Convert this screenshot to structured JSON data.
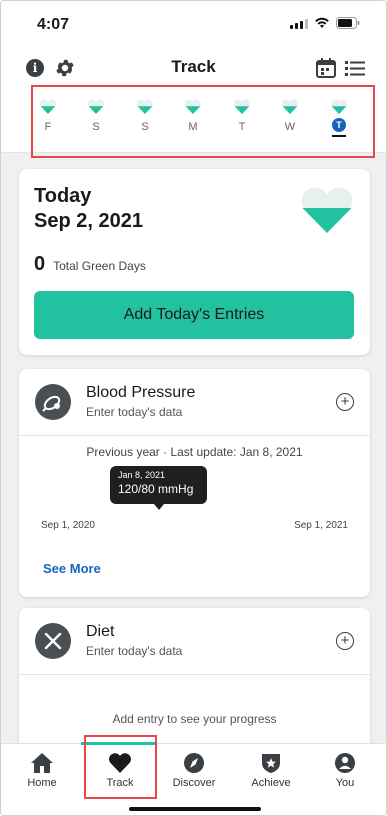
{
  "status_bar": {
    "time": "4:07"
  },
  "header": {
    "title": "Track",
    "icons": [
      "info-icon",
      "gear-icon",
      "calendar-icon",
      "list-icon"
    ]
  },
  "week": {
    "days": [
      {
        "label": "F",
        "active": false
      },
      {
        "label": "S",
        "active": false
      },
      {
        "label": "S",
        "active": false
      },
      {
        "label": "M",
        "active": false
      },
      {
        "label": "T",
        "active": false
      },
      {
        "label": "W",
        "active": false
      },
      {
        "label": "T",
        "active": true
      }
    ]
  },
  "today_card": {
    "title_line1": "Today",
    "title_line2": "Sep 2, 2021",
    "green_days_count": "0",
    "green_days_label": "Total Green Days",
    "add_button_label": "Add Today's Entries"
  },
  "blood_pressure": {
    "title": "Blood Pressure",
    "subtitle": "Enter today's data",
    "meta": "Previous year · Last update: Jan 8, 2021",
    "tooltip_date": "Jan 8, 2021",
    "tooltip_value": "120/80 mmHg",
    "axis_start": "Sep 1, 2020",
    "axis_end": "Sep 1, 2021",
    "see_more": "See More"
  },
  "diet": {
    "title": "Diet",
    "subtitle": "Enter today's data",
    "hint": "Add entry to see your progress"
  },
  "tabs": [
    {
      "label": "Home",
      "icon": "home-icon",
      "active": false
    },
    {
      "label": "Track",
      "icon": "heart-icon",
      "active": true
    },
    {
      "label": "Discover",
      "icon": "compass-icon",
      "active": false
    },
    {
      "label": "Achieve",
      "icon": "shield-star-icon",
      "active": false
    },
    {
      "label": "You",
      "icon": "person-icon",
      "active": false
    }
  ],
  "colors": {
    "accent": "#22c1a0",
    "link": "#1565c0",
    "highlight_box": "#e8474b",
    "dark_icon": "#3a3f44"
  }
}
